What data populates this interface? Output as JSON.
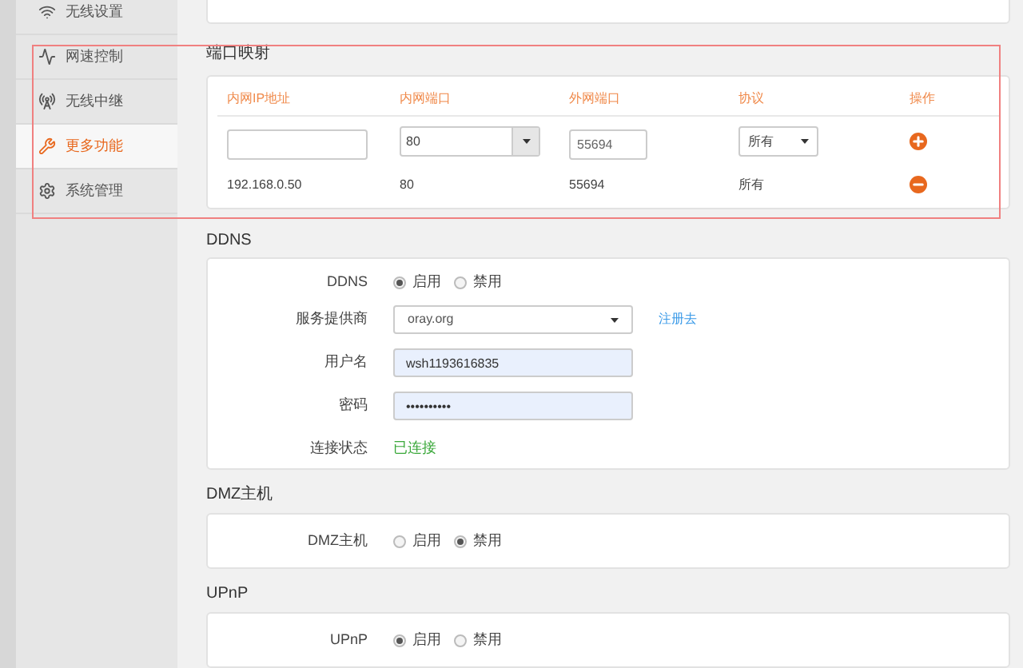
{
  "sidebar": {
    "items": [
      {
        "label": "无线设置",
        "selected": false
      },
      {
        "label": "网速控制",
        "selected": false
      },
      {
        "label": "无线中继",
        "selected": false
      },
      {
        "label": "更多功能",
        "selected": true
      },
      {
        "label": "系统管理",
        "selected": false
      }
    ]
  },
  "port_mapping": {
    "title": "端口映射",
    "columns": [
      "内网IP地址",
      "内网端口",
      "外网端口",
      "协议",
      "操作"
    ],
    "new_row": {
      "internal_port": "80",
      "external_port": "55694",
      "protocol": "所有"
    },
    "rows": [
      {
        "ip": "192.168.0.50",
        "internal_port": "80",
        "external_port": "55694",
        "protocol": "所有"
      }
    ]
  },
  "ddns": {
    "title": "DDNS",
    "fields": [
      {
        "kind": "radio",
        "label": "DDNS",
        "options": [
          {
            "label": "启用",
            "selected": true
          },
          {
            "label": "禁用",
            "selected": false
          }
        ]
      },
      {
        "kind": "select",
        "label": "服务提供商",
        "value": "oray.org",
        "link": "注册去"
      },
      {
        "kind": "text",
        "label": "用户名",
        "value": "wsh1193616835"
      },
      {
        "kind": "text",
        "label": "密码",
        "value": "••••••••••"
      },
      {
        "kind": "status",
        "label": "连接状态",
        "value": "已连接"
      }
    ]
  },
  "dmz": {
    "title": "DMZ主机",
    "label": "DMZ主机",
    "options": [
      {
        "label": "启用",
        "selected": false
      },
      {
        "label": "禁用",
        "selected": true
      }
    ]
  },
  "upnp": {
    "title": "UPnP",
    "label": "UPnP",
    "options": [
      {
        "label": "启用",
        "selected": true
      },
      {
        "label": "禁用",
        "selected": false
      }
    ]
  }
}
